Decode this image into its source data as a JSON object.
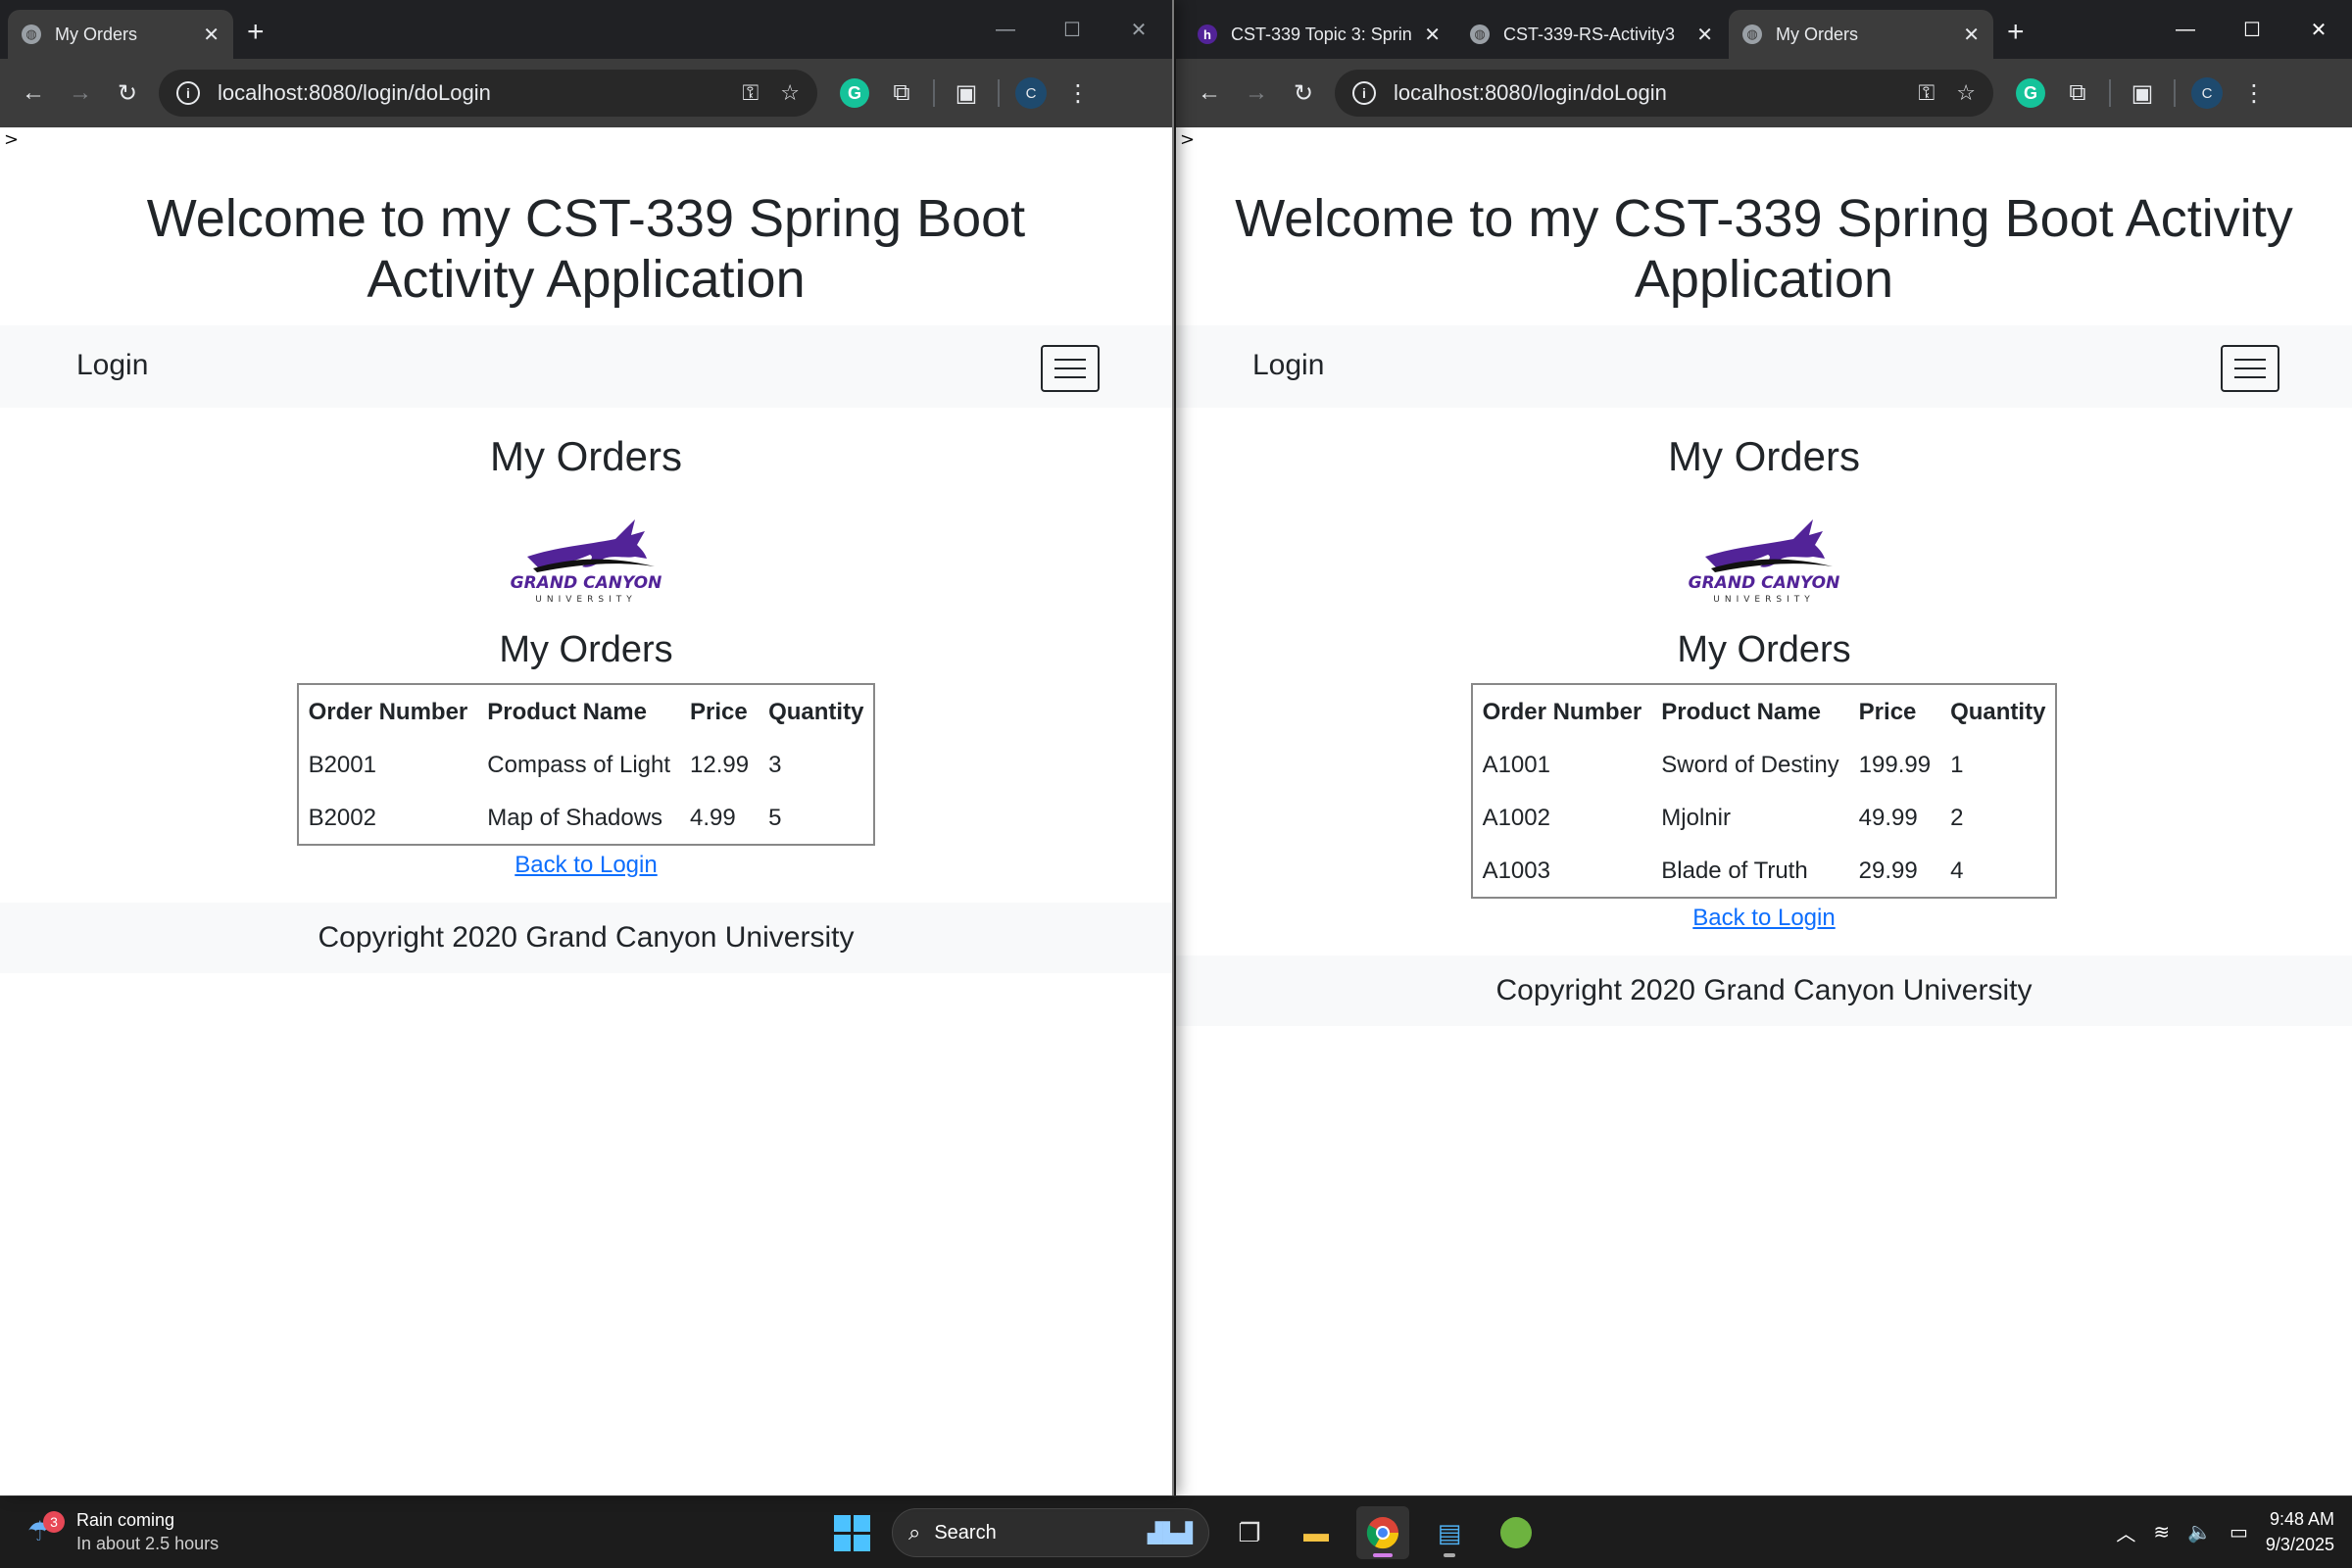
{
  "windows": [
    {
      "id": "left",
      "tabs": [
        {
          "title": "My Orders",
          "favicon": "globe-icon",
          "active": true
        }
      ],
      "url": "localhost:8080/login/doLogin",
      "page": {
        "stray_char": ">",
        "welcome": "Welcome to my CST-339 Spring Boot Activity Application",
        "nav_brand": "Login",
        "heading": "My Orders",
        "table_heading": "My Orders",
        "columns": [
          "Order Number",
          "Product Name",
          "Price",
          "Quantity"
        ],
        "rows": [
          [
            "B2001",
            "Compass of Light",
            "12.99",
            "3"
          ],
          [
            "B2002",
            "Map of Shadows",
            "4.99",
            "5"
          ]
        ],
        "back_link": "Back to Login",
        "footer": "Copyright 2020 Grand Canyon University"
      }
    },
    {
      "id": "right",
      "tabs": [
        {
          "title": "CST-339 Topic 3: Sprin",
          "favicon": "gcu-icon",
          "active": false
        },
        {
          "title": "CST-339-RS-Activity3",
          "favicon": "globe-icon",
          "active": false
        },
        {
          "title": "My Orders",
          "favicon": "globe-icon",
          "active": true
        }
      ],
      "url": "localhost:8080/login/doLogin",
      "page": {
        "stray_char": ">",
        "welcome": "Welcome to my CST-339 Spring Boot Activity Application",
        "nav_brand": "Login",
        "heading": "My Orders",
        "table_heading": "My Orders",
        "columns": [
          "Order Number",
          "Product Name",
          "Price",
          "Quantity"
        ],
        "rows": [
          [
            "A1001",
            "Sword of Destiny",
            "199.99",
            "1"
          ],
          [
            "A1002",
            "Mjolnir",
            "49.99",
            "2"
          ],
          [
            "A1003",
            "Blade of Truth",
            "29.99",
            "4"
          ]
        ],
        "back_link": "Back to Login",
        "footer": "Copyright 2020 Grand Canyon University"
      }
    }
  ],
  "logo": {
    "line1": "GRAND CANYON",
    "line2": "UNIVERSITY",
    "color": "#522398"
  },
  "taskbar": {
    "weather": {
      "badge": "3",
      "title": "Rain coming",
      "subtitle": "In about 2.5 hours"
    },
    "search_placeholder": "Search",
    "clock": {
      "time": "9:48 AM",
      "date": "9/3/2025"
    },
    "apps": [
      "task-view-icon",
      "file-explorer-icon",
      "chrome-icon",
      "notepad-icon",
      "spring-tool-suite-icon"
    ]
  },
  "colors": {
    "link": "#0d6efd",
    "accent": "#522398",
    "chrome_dark": "#202124"
  }
}
